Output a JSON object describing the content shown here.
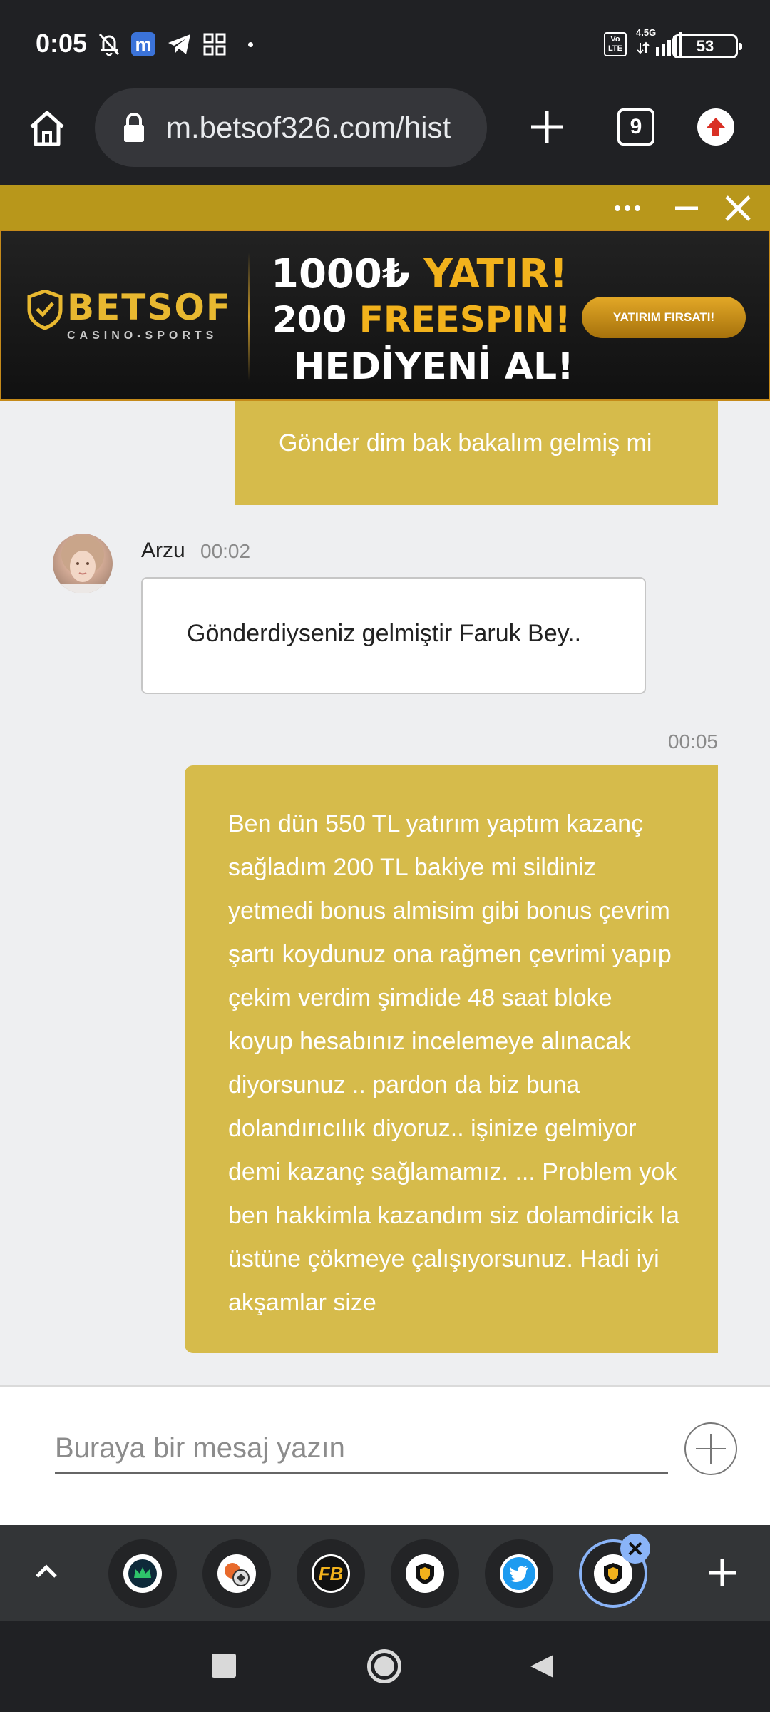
{
  "status_bar": {
    "time": "0:05",
    "network_label": "4.5G",
    "volte_label": "Vo LTE",
    "battery": "53",
    "icons": [
      "mute-bell-icon",
      "m-app-icon",
      "telegram-icon",
      "apps-grid-icon",
      "dot-icon",
      "volte-icon",
      "signal-icon",
      "battery-icon"
    ]
  },
  "browser": {
    "url": "m.betsof326.com/hist",
    "tab_count": "9",
    "icons": [
      "home-icon",
      "lock-icon",
      "plus-icon",
      "tabs-icon",
      "update-icon"
    ]
  },
  "ad": {
    "logo_text": "BETSOF",
    "logo_sub": "CASINO-SPORTS",
    "line1_a": "1000₺ ",
    "line1_b": "YATIR!",
    "line2_a": "200 ",
    "line2_b": "FREESPIN!",
    "line3": "HEDİYENİ AL!",
    "cta": "YATIRIM FIRSATI!",
    "colors": {
      "gold": "#f2b21c",
      "toolbar": "#b8971b"
    }
  },
  "chat": {
    "messages": [
      {
        "direction": "out",
        "text": "Gönder dim bak bakalım gelmiş mi"
      },
      {
        "direction": "in",
        "sender": "Arzu",
        "time": "00:02",
        "text": "Gönderdiyseniz gelmiştir Faruk Bey.."
      },
      {
        "direction": "out",
        "time": "00:05",
        "text": "Ben dün 550 TL yatırım yaptım kazanç sağladım 200 TL bakiye mi sildiniz yetmedi bonus almisim gibi bonus çevrim şartı koydunuz ona rağmen çevrimi yapıp çekim verdim şimdide 48 saat bloke koyup hesabınız incelemeye alınacak diyorsunuz .. pardon da biz buna dolandırıcılık diyoruz.. işinize gelmiyor demi kazanç sağlamamız. ... Problem yok ben hakkimla kazandım siz dolamdiricik la üstüne çökmeye çalışıyorsunuz. Hadi iyi akşamlar size"
      }
    ],
    "bubble_color": "#d6bb4b"
  },
  "composer": {
    "placeholder": "Buraya bir mesaj yazın"
  },
  "bubbles": {
    "items": [
      "crown-app-icon",
      "sports-ball-app-icon",
      "fb-app-icon",
      "betsof-app-icon",
      "twitter-app-icon",
      "betsof-active-app-icon"
    ]
  }
}
